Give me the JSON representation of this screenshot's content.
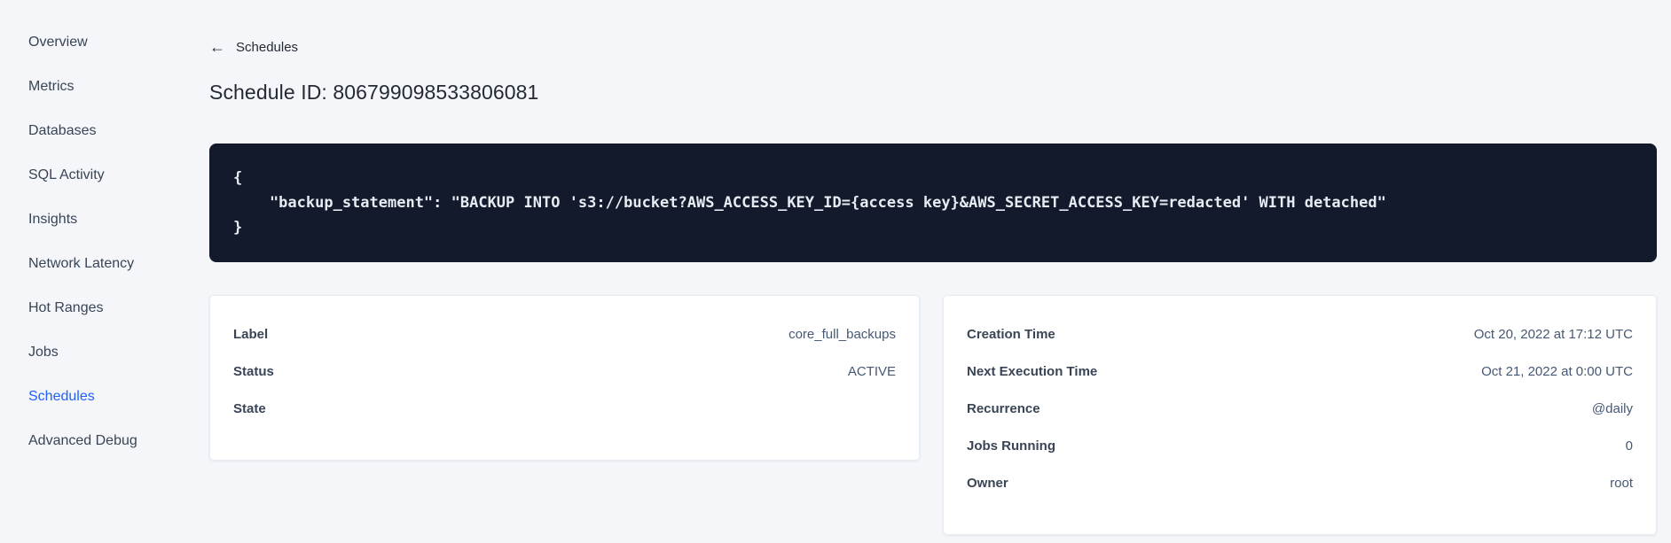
{
  "sidebar": {
    "items": [
      {
        "label": "Overview",
        "active": false
      },
      {
        "label": "Metrics",
        "active": false
      },
      {
        "label": "Databases",
        "active": false
      },
      {
        "label": "SQL Activity",
        "active": false
      },
      {
        "label": "Insights",
        "active": false
      },
      {
        "label": "Network Latency",
        "active": false
      },
      {
        "label": "Hot Ranges",
        "active": false
      },
      {
        "label": "Jobs",
        "active": false
      },
      {
        "label": "Schedules",
        "active": true
      },
      {
        "label": "Advanced Debug",
        "active": false
      }
    ]
  },
  "header": {
    "back_icon": "arrow-left",
    "back_label": "Schedules",
    "title": "Schedule ID: 806799098533806081"
  },
  "code_block": {
    "lines": [
      "{",
      "    \"backup_statement\": \"BACKUP INTO 's3://bucket?AWS_ACCESS_KEY_ID={access key}&AWS_SECRET_ACCESS_KEY=redacted' WITH detached\"",
      "}"
    ]
  },
  "details_card": {
    "rows": [
      {
        "label": "Label",
        "value": "core_full_backups"
      },
      {
        "label": "Status",
        "value": "ACTIVE"
      },
      {
        "label": "State",
        "value": ""
      }
    ]
  },
  "schedule_card": {
    "rows": [
      {
        "label": "Creation Time",
        "value": "Oct 20, 2022 at 17:12 UTC"
      },
      {
        "label": "Next Execution Time",
        "value": "Oct 21, 2022 at 0:00 UTC"
      },
      {
        "label": "Recurrence",
        "value": "@daily"
      },
      {
        "label": "Jobs Running",
        "value": "0"
      },
      {
        "label": "Owner",
        "value": "root"
      }
    ]
  },
  "colors": {
    "page_bg": "#f4f6fa",
    "active_link": "#2161f5",
    "code_bg": "#131a2b",
    "code_text": "#e7ecf3",
    "text_primary": "#394455",
    "text_value": "#475872"
  }
}
